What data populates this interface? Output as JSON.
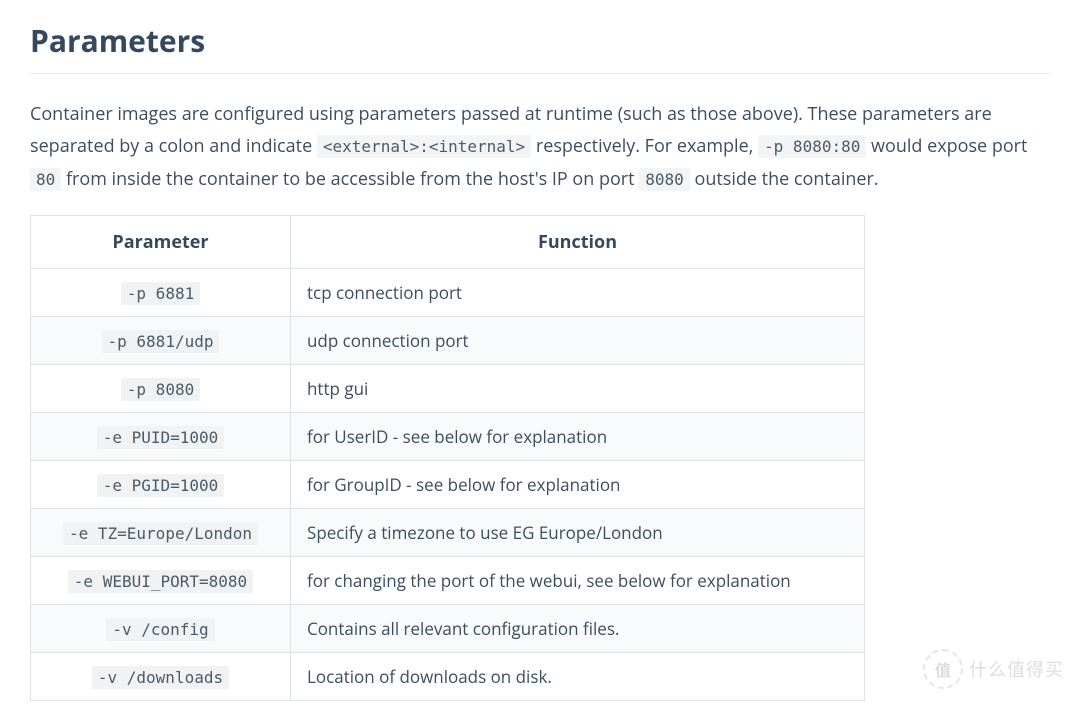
{
  "heading": "Parameters",
  "intro": {
    "part1": "Container images are configured using parameters passed at runtime (such as those above). These parameters are separated by a colon and indicate ",
    "code1": "<external>:<internal>",
    "part2": " respectively. For example, ",
    "code2": "-p 8080:80",
    "part3": " would expose port ",
    "code3": "80",
    "part4": " from inside the container to be accessible from the host's IP on port ",
    "code4": "8080",
    "part5": " outside the container."
  },
  "table": {
    "headers": {
      "param": "Parameter",
      "func": "Function"
    },
    "rows": [
      {
        "param": "-p 6881",
        "func": "tcp connection port"
      },
      {
        "param": "-p 6881/udp",
        "func": "udp connection port"
      },
      {
        "param": "-p 8080",
        "func": "http gui"
      },
      {
        "param": "-e PUID=1000",
        "func": "for UserID - see below for explanation"
      },
      {
        "param": "-e PGID=1000",
        "func": "for GroupID - see below for explanation"
      },
      {
        "param": "-e TZ=Europe/London",
        "func": "Specify a timezone to use EG Europe/London"
      },
      {
        "param": "-e WEBUI_PORT=8080",
        "func": "for changing the port of the webui, see below for explanation"
      },
      {
        "param": "-v /config",
        "func": "Contains all relevant configuration files."
      },
      {
        "param": "-v /downloads",
        "func": "Location of downloads on disk."
      }
    ]
  },
  "watermark": {
    "badge": "值",
    "text": "什么值得买"
  }
}
